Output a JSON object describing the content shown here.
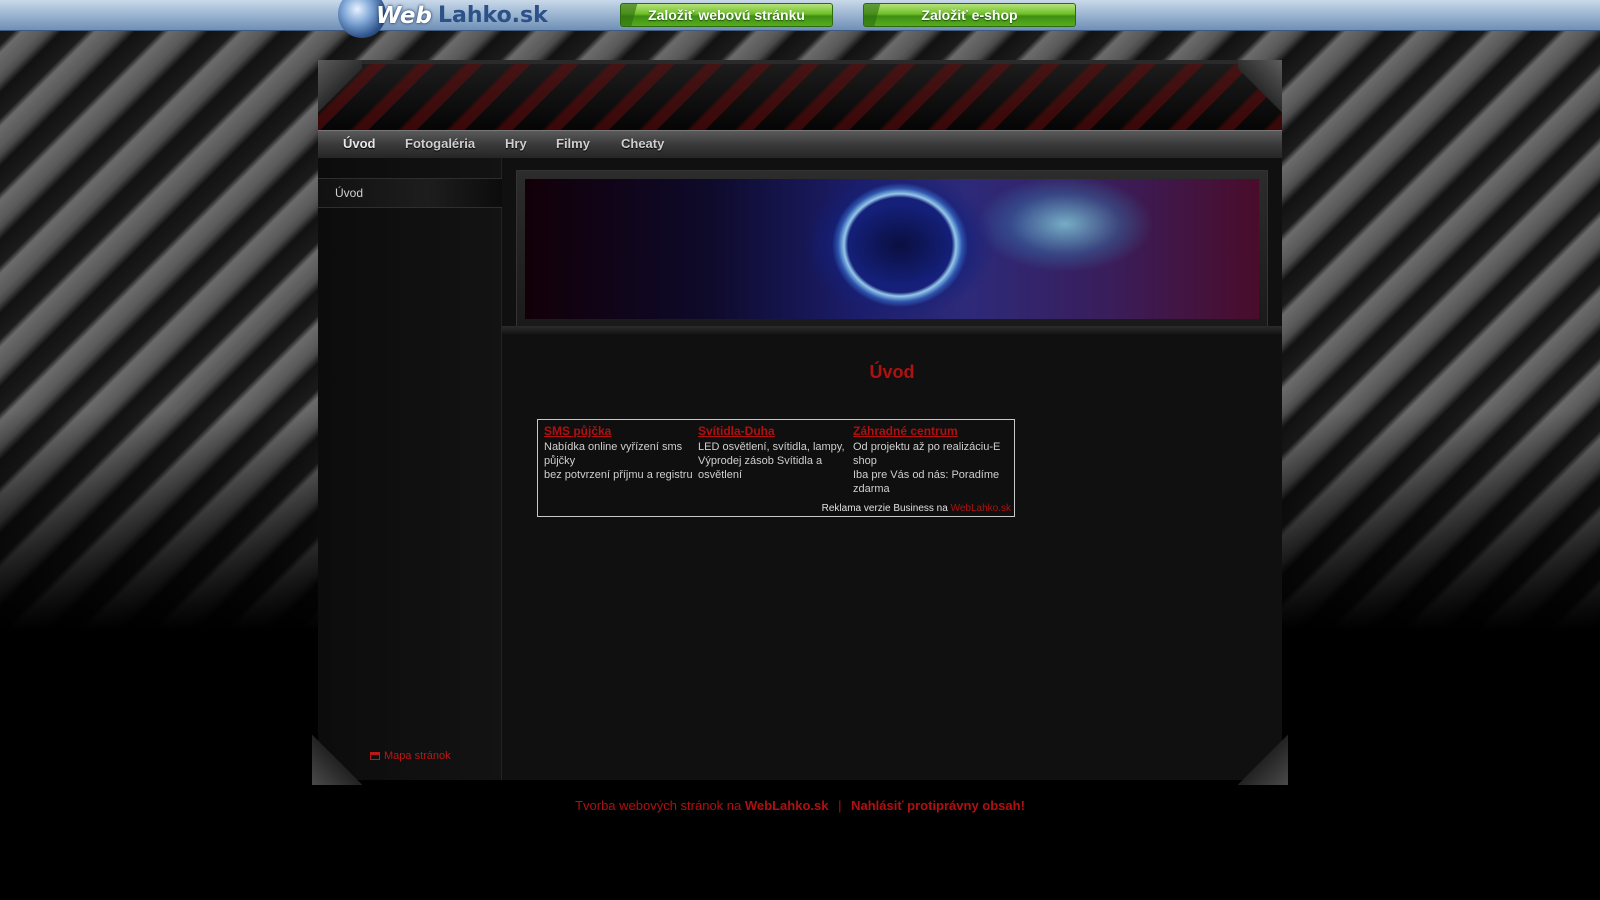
{
  "topbar": {
    "brand_web": "Web",
    "brand_lahko": "Lahko.sk",
    "btn_create_site": "Založiť webovú stránku",
    "btn_create_shop": "Založiť e-shop"
  },
  "nav": {
    "items": [
      "Úvod",
      "Fotogaléria",
      "Hry",
      "Filmy",
      "Cheaty"
    ]
  },
  "sidebar": {
    "link": "Úvod",
    "sitemap": "Mapa stránok"
  },
  "content": {
    "title": "Úvod"
  },
  "ads": [
    {
      "title": "SMS půjčka",
      "line1": "Nabídka online vyřízení sms půjčky",
      "line2": "bez potvrzení příjmu a registru"
    },
    {
      "title": "Svítidla-Duha",
      "line1": "LED osvětlení, svítidla, lampy,",
      "line2": "Výprodej zásob Svítidla a osvětlení"
    },
    {
      "title": "Záhradné centrum",
      "line1": "Od projektu až po realizáciu-E shop",
      "line2": "Iba pre Vás od nás: Poradíme zdarma"
    }
  ],
  "ad_footer": {
    "text": "Reklama verzie Business na",
    "link": "WebLahko.sk"
  },
  "footer": {
    "text": "Tvorba webových stránok na",
    "brand": "WebLahko.sk",
    "separator": "|",
    "report": "Nahlásiť protiprávny obsah!"
  },
  "colors": {
    "accent_red": "#b01010",
    "topbar_blue": "#9fb8d3",
    "green_button": "#6fbf2a"
  }
}
